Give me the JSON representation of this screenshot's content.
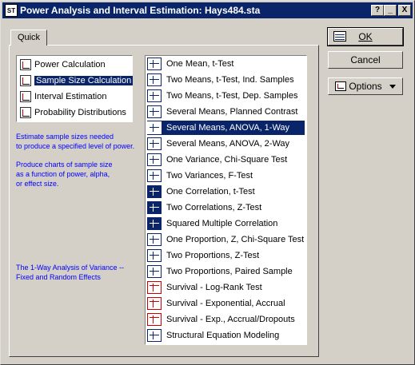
{
  "window": {
    "title": "Power Analysis and Interval Estimation: Hays484.sta",
    "controls": {
      "help": "?",
      "minimize": "_",
      "close": "X"
    }
  },
  "tab": {
    "label": "Quick"
  },
  "left_list": [
    {
      "label": "Power Calculation",
      "icon": "power-chart-icon",
      "selected": false
    },
    {
      "label": "Sample Size Calculation",
      "icon": "sample-size-icon",
      "selected": true
    },
    {
      "label": "Interval Estimation",
      "icon": "interval-icon",
      "selected": false
    },
    {
      "label": "Probability Distributions",
      "icon": "distribution-icon",
      "selected": false
    }
  ],
  "descriptions": {
    "line1": "Estimate sample sizes needed",
    "line2": "to produce a specified level of power.",
    "line3": "Produce charts of sample size",
    "line4": "as a function of power, alpha,",
    "line5": "or effect size.",
    "line6": "The 1-Way Analysis of Variance --",
    "line7": "Fixed and Random Effects"
  },
  "right_list": [
    {
      "label": "One Mean, t-Test",
      "icon": "test-icon",
      "selected": false
    },
    {
      "label": "Two Means, t-Test, Ind. Samples",
      "icon": "test-icon",
      "selected": false
    },
    {
      "label": "Two Means, t-Test, Dep. Samples",
      "icon": "test-icon",
      "selected": false
    },
    {
      "label": "Several Means, Planned Contrast",
      "icon": "test-icon",
      "selected": false
    },
    {
      "label": "Several Means, ANOVA, 1-Way",
      "icon": "anova-icon",
      "selected": true
    },
    {
      "label": "Several Means, ANOVA, 2-Way",
      "icon": "anova-icon",
      "selected": false
    },
    {
      "label": "One Variance, Chi-Square Test",
      "icon": "test-icon",
      "selected": false
    },
    {
      "label": "Two Variances, F-Test",
      "icon": "test-icon",
      "selected": false
    },
    {
      "label": "One Correlation, t-Test",
      "icon": "correlation-icon",
      "selected": false
    },
    {
      "label": "Two Correlations, Z-Test",
      "icon": "correlation-icon",
      "selected": false
    },
    {
      "label": "Squared Multiple Correlation",
      "icon": "correlation-icon",
      "selected": false
    },
    {
      "label": "One Proportion, Z, Chi-Square Test",
      "icon": "test-icon",
      "selected": false
    },
    {
      "label": "Two Proportions, Z-Test",
      "icon": "test-icon",
      "selected": false
    },
    {
      "label": "Two Proportions, Paired Sample",
      "icon": "test-icon",
      "selected": false
    },
    {
      "label": "Survival - Log-Rank Test",
      "icon": "survival-icon",
      "selected": false
    },
    {
      "label": "Survival - Exponential, Accrual",
      "icon": "survival-icon",
      "selected": false
    },
    {
      "label": "Survival - Exp., Accrual/Dropouts",
      "icon": "survival-icon",
      "selected": false
    },
    {
      "label": "Structural Equation Modeling",
      "icon": "sem-icon",
      "selected": false
    }
  ],
  "buttons": {
    "ok": "OK",
    "cancel": "Cancel",
    "options": "Options"
  },
  "colors": {
    "titlebar": "#0a246a",
    "selection": "#0a246a",
    "description_text": "#0000ff",
    "face": "#d4d0c8"
  }
}
